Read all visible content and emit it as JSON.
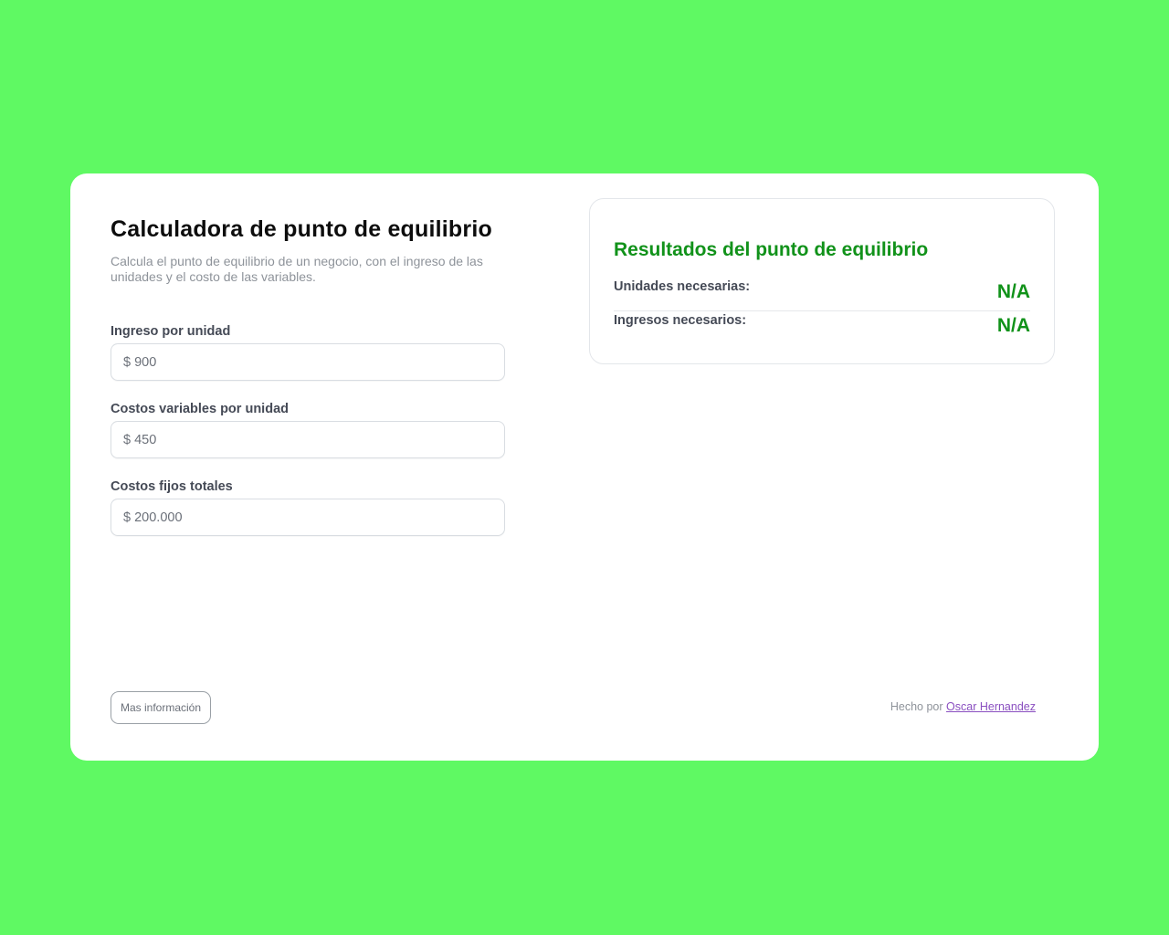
{
  "calculator": {
    "title": "Calculadora de punto de equilibrio",
    "subtitle": "Calcula el punto de equilibrio de un negocio, con el ingreso de las unidades y el costo de las variables.",
    "fields": [
      {
        "label": "Ingreso por unidad",
        "placeholder": "$ 900"
      },
      {
        "label": "Costos variables por unidad",
        "placeholder": "$ 450"
      },
      {
        "label": "Costos fijos totales",
        "placeholder": "$ 200.000"
      }
    ]
  },
  "results": {
    "title": "Resultados del punto de equilibrio",
    "rows": [
      {
        "label": "Unidades necesarias:",
        "value": "N/A"
      },
      {
        "label": "Ingresos necesarios:",
        "value": "N/A"
      }
    ]
  },
  "footer": {
    "more_info_label": "Mas información",
    "credit_prefix": "Hecho por",
    "credit_author": "Oscar Hernandez"
  },
  "colors": {
    "background": "#5ff963",
    "accent": "#11921a",
    "link": "#8a4fc0"
  }
}
